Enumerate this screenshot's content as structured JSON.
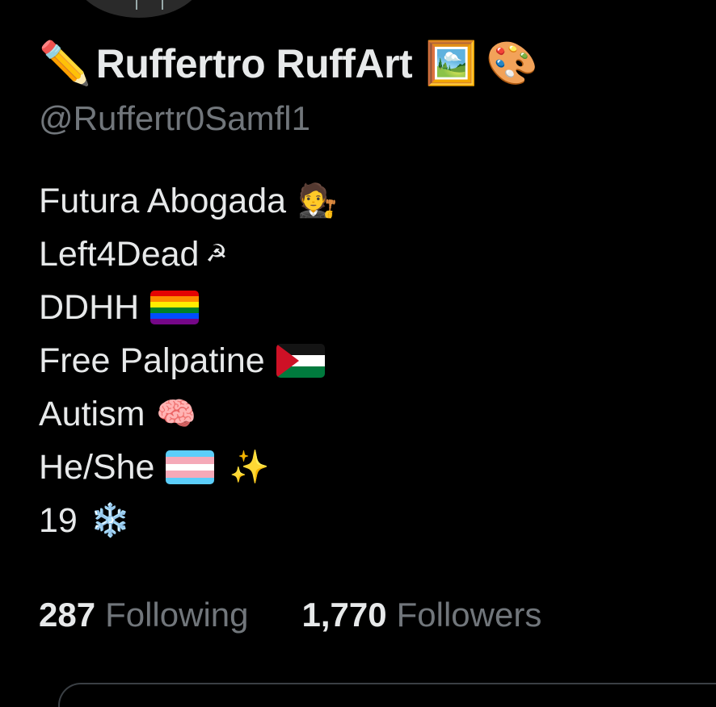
{
  "profile": {
    "name_prefix_icon": "✏️",
    "display_name": "Ruffertro RuffArt",
    "name_suffix_icons": [
      "🖼️",
      "🎨"
    ],
    "handle": "@Ruffertr0Samfl1"
  },
  "bio": [
    {
      "text": "Futura Abogada",
      "emoji": "🧑‍⚖️",
      "icon_name": "judge-icon"
    },
    {
      "text": "Left4Dead",
      "emoji": "☭",
      "icon_name": "hammer-sickle-icon"
    },
    {
      "text": "DDHH",
      "emoji": "",
      "icon_name": "rainbow-flag-icon"
    },
    {
      "text": "Free Palpatine",
      "emoji": "",
      "icon_name": "palestine-flag-icon"
    },
    {
      "text": "Autism",
      "emoji": "🧠",
      "icon_name": "brain-icon"
    },
    {
      "text": "He/She",
      "emoji": "✨",
      "icon_name": "transgender-flag-icon"
    },
    {
      "text": "19",
      "emoji": "❄️",
      "icon_name": "snowflake-icon"
    }
  ],
  "stats": {
    "following_count": "287",
    "following_label": "Following",
    "followers_count": "1,770",
    "followers_label": "Followers"
  },
  "colors": {
    "background": "#000000",
    "primary_text": "#e7e9ea",
    "secondary_text": "#71767b"
  }
}
